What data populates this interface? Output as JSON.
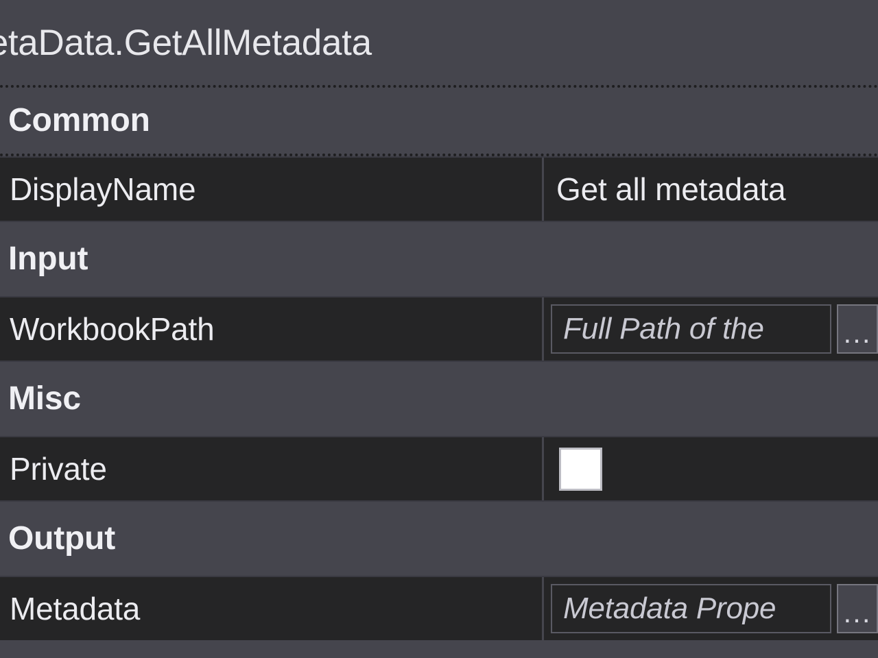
{
  "panel": {
    "title": "celMetaData.GetAllMetadata",
    "title_full_hint_visible": "celMetaData.GetAllMetadata"
  },
  "colors": {
    "panel_background": "#45454d",
    "row_background": "#252526",
    "text_primary": "#ececf0",
    "placeholder_text": "#c9c9d2",
    "divider": "#3a3a42",
    "checkbox_fill": "#ffffff",
    "editor_border": "#5a5a63",
    "button_border": "#76767f"
  },
  "categories": [
    {
      "name": "common",
      "label": "Common",
      "selected": true,
      "rows": [
        {
          "name": "display-name",
          "label": "DisplayName",
          "type": "text",
          "value": "Get all metadata"
        }
      ]
    },
    {
      "name": "input",
      "label": "Input",
      "selected": false,
      "rows": [
        {
          "name": "workbook-path",
          "label": "WorkbookPath",
          "type": "expression",
          "placeholder": "Full Path of the",
          "browse_label": "..."
        }
      ]
    },
    {
      "name": "misc",
      "label": "Misc",
      "selected": false,
      "rows": [
        {
          "name": "private",
          "label": "Private",
          "type": "checkbox",
          "checked": false
        }
      ]
    },
    {
      "name": "output",
      "label": "Output",
      "selected": false,
      "rows": [
        {
          "name": "metadata",
          "label": "Metadata",
          "type": "expression",
          "placeholder": "Metadata Prope",
          "browse_label": "..."
        }
      ]
    }
  ]
}
